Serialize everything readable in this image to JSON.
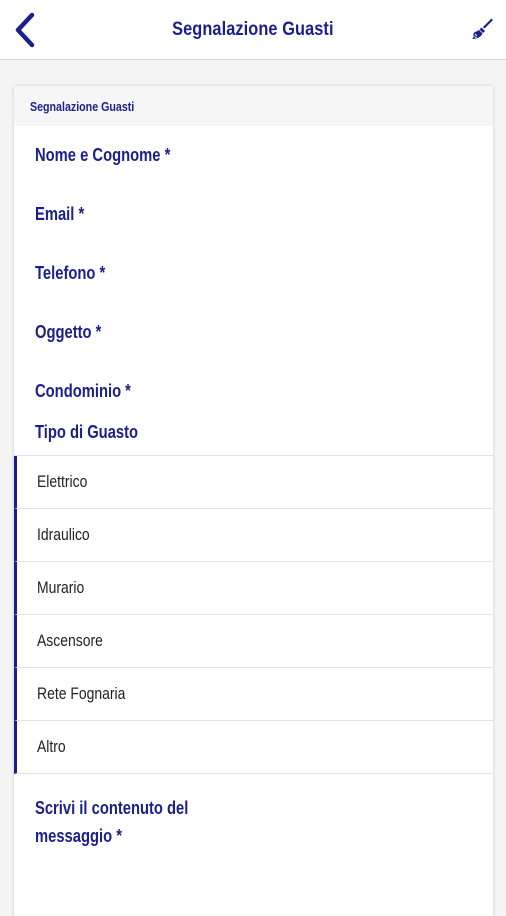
{
  "header": {
    "title": "Segnalazione Guasti",
    "back_icon": "chevron-left-icon",
    "action_icon": "brush-icon",
    "accent_color": "#1b1f8a"
  },
  "form": {
    "card_title": "Segnalazione Guasti",
    "fields": [
      {
        "label": "Nome e Cognome *"
      },
      {
        "label": "Email *"
      },
      {
        "label": "Telefono *"
      },
      {
        "label": "Oggetto *"
      },
      {
        "label": "Condominio *"
      }
    ],
    "fault_type": {
      "title": "Tipo di Guasto",
      "options": [
        "Elettrico",
        "Idraulico",
        "Murario",
        "Ascensore",
        "Rete Fognaria",
        "Altro"
      ]
    },
    "message_label_line1": "Scrivi il contenuto del",
    "message_label_line2": "messaggio *"
  }
}
